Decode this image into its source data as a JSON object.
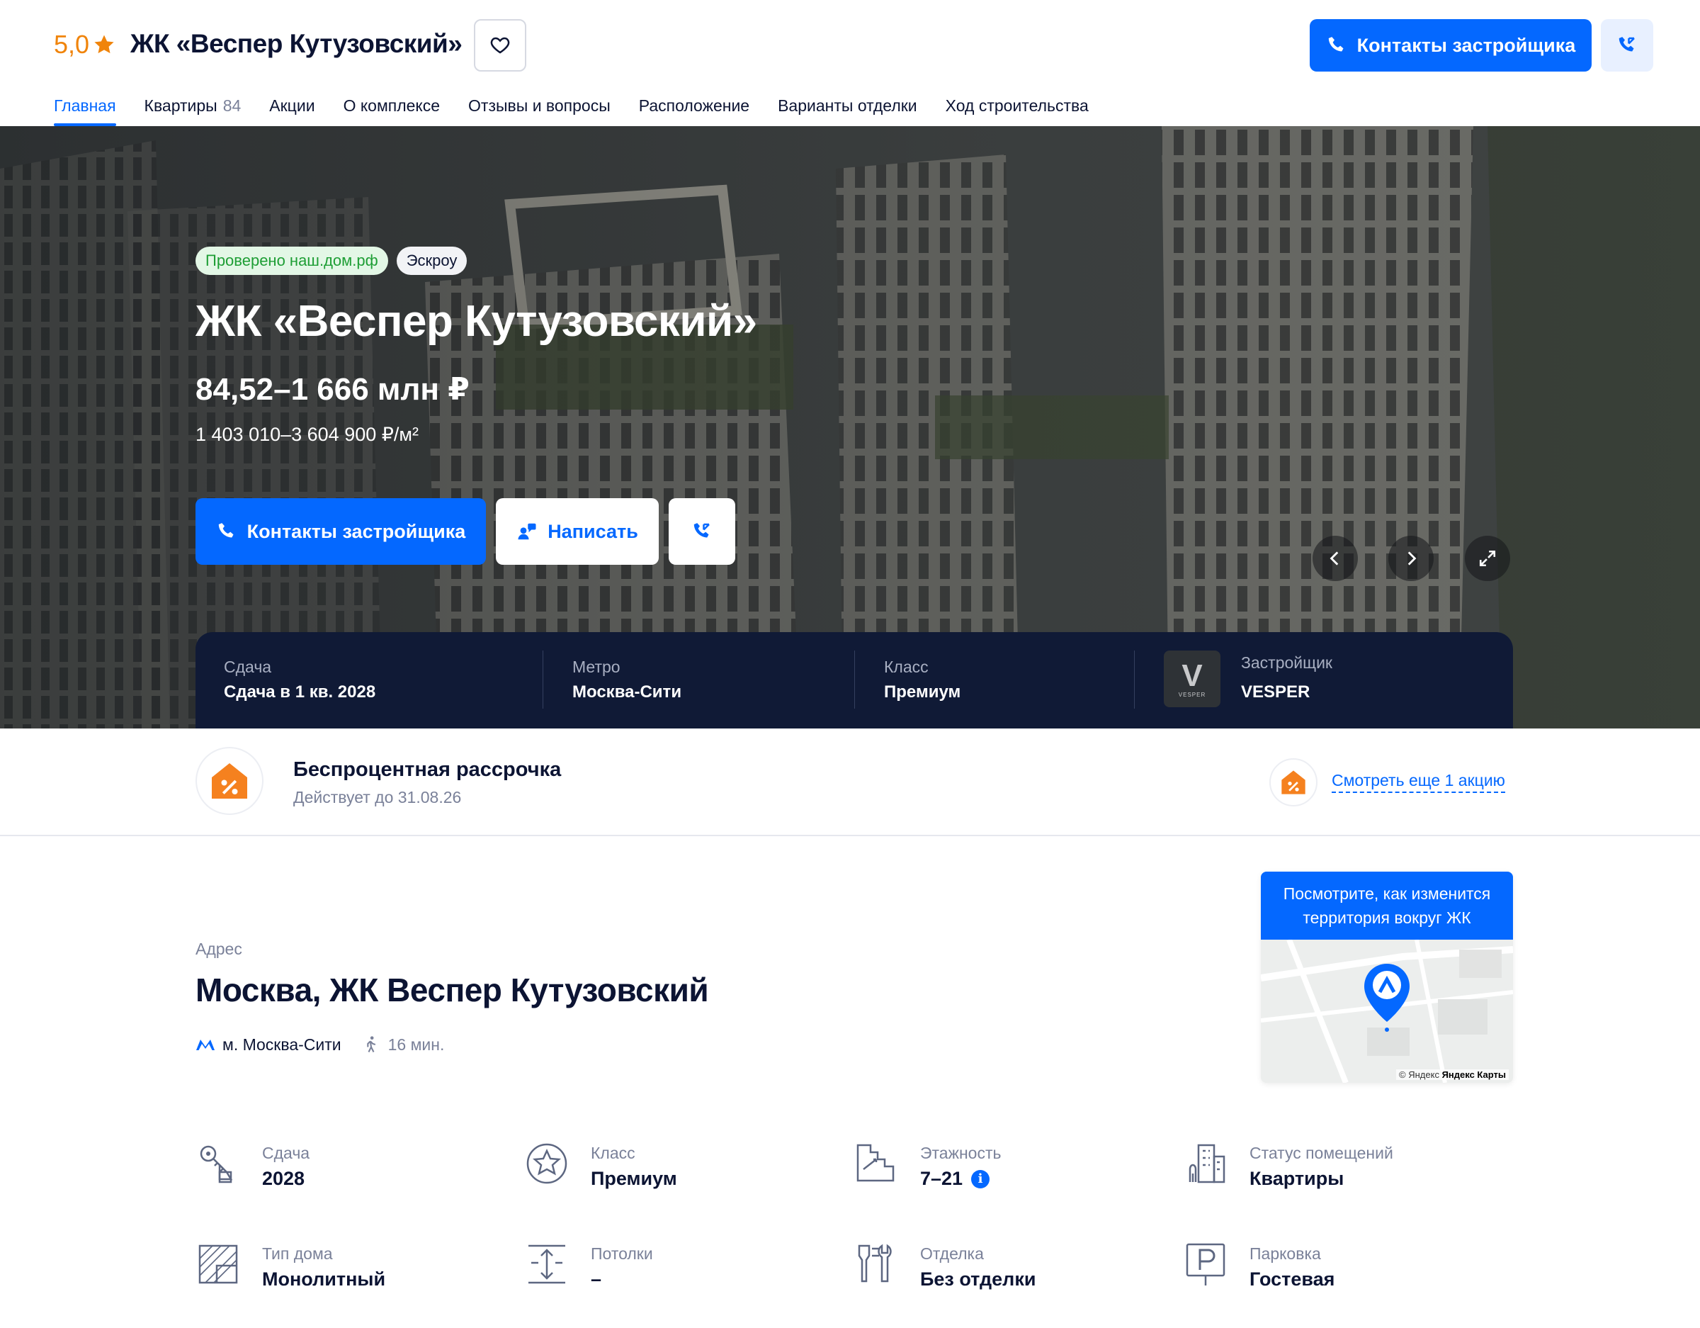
{
  "header": {
    "rating": "5,0",
    "title": "ЖК «Веспер Кутузовский»",
    "contacts_label": "Контакты застройщика"
  },
  "nav": [
    {
      "label": "Главная",
      "active": true
    },
    {
      "label": "Квартиры",
      "count": "84"
    },
    {
      "label": "Акции"
    },
    {
      "label": "О комплексе"
    },
    {
      "label": "Отзывы и вопросы"
    },
    {
      "label": "Расположение"
    },
    {
      "label": "Варианты отделки"
    },
    {
      "label": "Ход строительства"
    }
  ],
  "hero": {
    "badge_verified": "Проверено наш.дом.рф",
    "badge_escrow": "Эскроу",
    "title": "ЖК «Веспер Кутузовский»",
    "price": "84,52–1 666 млн ₽",
    "price_per_sqm": "1 403 010–3 604 900 ₽/м²",
    "contacts_label": "Контакты застройщика",
    "write_label": "Написать"
  },
  "info_bar": {
    "completion_label": "Сдача",
    "completion_value": "Сдача в 1 кв. 2028",
    "metro_label": "Метро",
    "metro_value": "Москва-Сити",
    "class_label": "Класс",
    "class_value": "Премиум",
    "developer_label": "Застройщик",
    "developer_value": "VESPER",
    "developer_logo_letter": "V",
    "developer_logo_word": "VESPER"
  },
  "promo": {
    "title": "Беспроцентная рассрочка",
    "subtitle": "Действует до 31.08.26",
    "more_label": "Смотреть еще 1 акцию"
  },
  "address": {
    "label": "Адрес",
    "title": "Москва, ЖК Веспер Кутузовский",
    "metro": "м. Москва-Сити",
    "walk_time": "16 мин."
  },
  "map": {
    "header": "Посмотрите, как изменится территория вокруг ЖК",
    "copyright": "© Яндекс",
    "brand": "Яндекс Карты"
  },
  "params": {
    "completion": {
      "label": "Сдача",
      "value": "2028"
    },
    "class": {
      "label": "Класс",
      "value": "Премиум"
    },
    "floors": {
      "label": "Этажность",
      "value": "7–21"
    },
    "status": {
      "label": "Статус помещений",
      "value": "Квартиры"
    },
    "house_type": {
      "label": "Тип дома",
      "value": "Монолитный"
    },
    "ceilings": {
      "label": "Потолки",
      "value": "–"
    },
    "finishing": {
      "label": "Отделка",
      "value": "Без отделки"
    },
    "parking": {
      "label": "Парковка",
      "value": "Гостевая"
    }
  },
  "colors": {
    "accent": "#0468ff",
    "rating": "#f0840b",
    "info_bar_bg": "#101a36",
    "verified_green": "#1e9e35"
  },
  "icons": [
    "star-icon",
    "heart-icon",
    "phone-icon",
    "chat-icon",
    "chevron-left-icon",
    "chevron-right-icon",
    "expand-icon",
    "discount-house-icon",
    "metro-icon",
    "walk-icon",
    "key-icon",
    "class-star-icon",
    "stairs-icon",
    "building-status-icon",
    "house-type-icon",
    "ceiling-height-icon",
    "finishing-tools-icon",
    "parking-icon",
    "map-pin-icon"
  ]
}
